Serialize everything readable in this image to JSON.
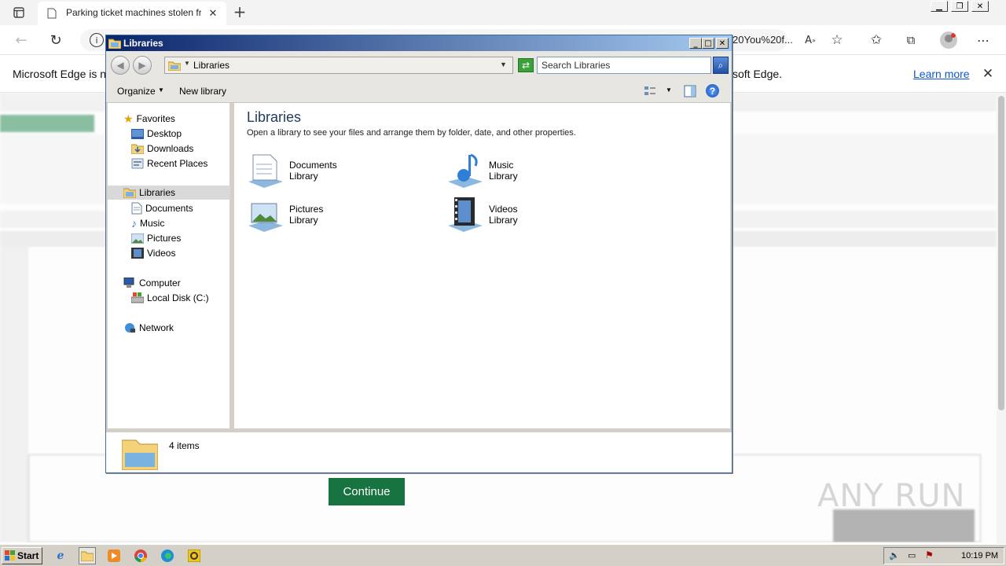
{
  "browser": {
    "tab_title": "Parking ticket machines stolen fr",
    "url_fragment": "20You%20f...",
    "new_tab": "+",
    "infobar_text_left": "Microsoft Edge is no",
    "infobar_text_right": "soft Edge.",
    "learn_more": "Learn more"
  },
  "background_page": {
    "continue_label": "Continue",
    "watermark": "ANY RUN"
  },
  "explorer": {
    "title": "Libraries",
    "address": "Libraries",
    "search_placeholder": "Search Libraries",
    "organize_label": "Organize",
    "new_library_label": "New library",
    "nav": {
      "favorites": "Favorites",
      "desktop": "Desktop",
      "downloads": "Downloads",
      "recent_places": "Recent Places",
      "libraries": "Libraries",
      "documents": "Documents",
      "music": "Music",
      "pictures": "Pictures",
      "videos": "Videos",
      "computer": "Computer",
      "local_disk": "Local Disk (C:)",
      "network": "Network"
    },
    "heading": "Libraries",
    "description": "Open a library to see your files and arrange them by folder, date, and other properties.",
    "libraries": [
      {
        "name": "Documents",
        "type": "Library"
      },
      {
        "name": "Music",
        "type": "Library"
      },
      {
        "name": "Pictures",
        "type": "Library"
      },
      {
        "name": "Videos",
        "type": "Library"
      }
    ],
    "status_count": "4 items"
  },
  "taskbar": {
    "start_label": "Start",
    "clock": "10:19 PM"
  }
}
